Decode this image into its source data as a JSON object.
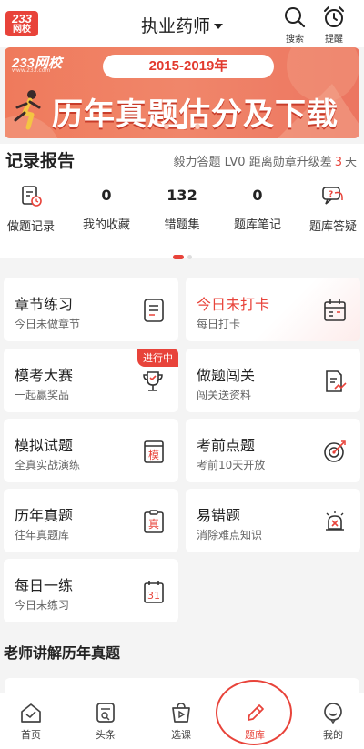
{
  "header": {
    "logo_line1": "233",
    "logo_line2": "网校",
    "title": "执业药师",
    "search_label": "搜索",
    "remind_label": "提醒"
  },
  "banner": {
    "brand": "233网校",
    "brand_url": "www.233.com",
    "years": "2015-2019年",
    "headline": "历年真题估分及下载",
    "slide_index": 1,
    "slide_count": 3
  },
  "records": {
    "title": "记录报告",
    "note_prefix": "毅力答题 LV0 距离勋章升级差",
    "note_count": "3",
    "note_unit": "天",
    "items": [
      {
        "label": "做题记录",
        "value": "",
        "icon": "clock-doc-icon"
      },
      {
        "label": "我的收藏",
        "value": "0"
      },
      {
        "label": "错题集",
        "value": "132"
      },
      {
        "label": "题库笔记",
        "value": "0"
      },
      {
        "label": "题库答疑",
        "value": "",
        "icon": "chat-question-icon"
      }
    ]
  },
  "cards": [
    {
      "title": "章节练习",
      "sub": "今日未做章节",
      "icon": "list-doc-icon"
    },
    {
      "title": "今日未打卡",
      "sub": "每日打卡",
      "icon": "calendar-icon",
      "highlight": true
    },
    {
      "title": "模考大赛",
      "sub": "一起赢奖品",
      "icon": "trophy-icon",
      "tag": "进行中"
    },
    {
      "title": "做题闯关",
      "sub": "闯关送资料",
      "icon": "doc-trend-icon"
    },
    {
      "title": "模拟试题",
      "sub": "全真实战演练",
      "icon": "mock-doc-icon",
      "glyph": "模"
    },
    {
      "title": "考前点题",
      "sub": "考前10天开放",
      "icon": "target-icon"
    },
    {
      "title": "历年真题",
      "sub": "往年真题库",
      "icon": "real-clipboard-icon",
      "glyph": "真"
    },
    {
      "title": "易错题",
      "sub": "消除难点知识",
      "icon": "alarm-icon"
    },
    {
      "title": "每日一练",
      "sub": "今日未练习",
      "icon": "calendar-31-icon",
      "glyph": "31"
    }
  ],
  "section": {
    "title": "老师讲解历年真题"
  },
  "nav": [
    {
      "label": "首页",
      "icon": "home-icon"
    },
    {
      "label": "头条",
      "icon": "news-icon"
    },
    {
      "label": "选课",
      "icon": "course-bag-icon"
    },
    {
      "label": "题库",
      "icon": "pencil-icon",
      "active": true
    },
    {
      "label": "我的",
      "icon": "smile-icon"
    }
  ],
  "colors": {
    "accent": "#e8433a",
    "banner": "#ef7a5c",
    "background": "#f4f4f4"
  }
}
